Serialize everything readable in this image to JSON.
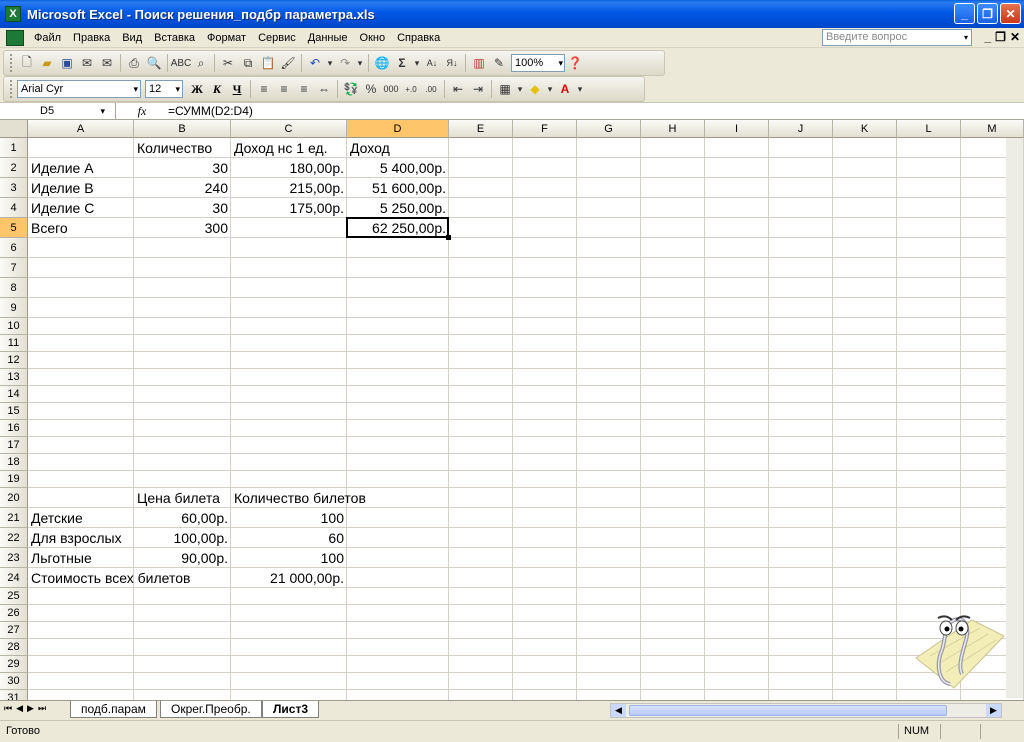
{
  "window": {
    "title": "Microsoft Excel - Поиск решения_подбр параметра.xls"
  },
  "menu": {
    "items": [
      "Файл",
      "Правка",
      "Вид",
      "Вставка",
      "Формат",
      "Сервис",
      "Данные",
      "Окно",
      "Справка"
    ],
    "help_placeholder": "Введите вопрос"
  },
  "toolbar": {
    "zoom": "100%"
  },
  "format_toolbar": {
    "font": "Arial Cyr",
    "size": "12",
    "bold": "Ж",
    "italic": "К",
    "underline": "Ч",
    "percent": "%",
    "thousands": "000"
  },
  "formula_bar": {
    "name_box": "D5",
    "fx": "fx",
    "formula": "=СУММ(D2:D4)"
  },
  "sheet": {
    "columns": [
      "A",
      "B",
      "C",
      "D",
      "E",
      "F",
      "G",
      "H",
      "I",
      "J",
      "K",
      "L",
      "M"
    ],
    "active_col": "D",
    "rows": [
      "1",
      "2",
      "3",
      "4",
      "5",
      "6",
      "7",
      "8",
      "9",
      "10",
      "11",
      "12",
      "13",
      "14",
      "15",
      "16",
      "17",
      "18",
      "19",
      "20",
      "21",
      "22",
      "23",
      "24",
      "25",
      "26",
      "27",
      "28",
      "29",
      "30",
      "31"
    ],
    "active_row": "5",
    "cells": [
      {
        "ref": "B1",
        "v": "Количество",
        "align": "l"
      },
      {
        "ref": "C1",
        "v": "Доход нс 1 ед.",
        "align": "l"
      },
      {
        "ref": "D1",
        "v": "Доход",
        "align": "l"
      },
      {
        "ref": "A2",
        "v": "Иделие А",
        "align": "l"
      },
      {
        "ref": "B2",
        "v": "30",
        "align": "r"
      },
      {
        "ref": "C2",
        "v": "180,00р.",
        "align": "r"
      },
      {
        "ref": "D2",
        "v": "5 400,00р.",
        "align": "r"
      },
      {
        "ref": "A3",
        "v": "Иделие В",
        "align": "l"
      },
      {
        "ref": "B3",
        "v": "240",
        "align": "r"
      },
      {
        "ref": "C3",
        "v": "215,00р.",
        "align": "r"
      },
      {
        "ref": "D3",
        "v": "51 600,00р.",
        "align": "r"
      },
      {
        "ref": "A4",
        "v": "Иделие С",
        "align": "l"
      },
      {
        "ref": "B4",
        "v": "30",
        "align": "r"
      },
      {
        "ref": "C4",
        "v": "175,00р.",
        "align": "r"
      },
      {
        "ref": "D4",
        "v": "5 250,00р.",
        "align": "r"
      },
      {
        "ref": "A5",
        "v": "Всего",
        "align": "l"
      },
      {
        "ref": "B5",
        "v": "300",
        "align": "r"
      },
      {
        "ref": "D5",
        "v": "62 250,00р.",
        "align": "r"
      },
      {
        "ref": "B20",
        "v": "Цена билета",
        "align": "l"
      },
      {
        "ref": "C20",
        "v": "Количество билетов",
        "align": "l"
      },
      {
        "ref": "A21",
        "v": "Детские",
        "align": "l"
      },
      {
        "ref": "B21",
        "v": "60,00р.",
        "align": "r"
      },
      {
        "ref": "C21",
        "v": "100",
        "align": "r"
      },
      {
        "ref": "A22",
        "v": "Для взрослых",
        "align": "l"
      },
      {
        "ref": "B22",
        "v": "100,00р.",
        "align": "r"
      },
      {
        "ref": "C22",
        "v": "60",
        "align": "r"
      },
      {
        "ref": "A23",
        "v": "Льготные",
        "align": "l"
      },
      {
        "ref": "B23",
        "v": "90,00р.",
        "align": "r"
      },
      {
        "ref": "C23",
        "v": "100",
        "align": "r"
      },
      {
        "ref": "A24",
        "v": "Стоимость всех билетов",
        "align": "l"
      },
      {
        "ref": "C24",
        "v": "21 000,00р.",
        "align": "r"
      }
    ]
  },
  "tabs": {
    "items": [
      "подб.парам",
      "Окрег.Преобр.",
      "Лист3"
    ],
    "active": "Лист3"
  },
  "status": {
    "text": "Готово",
    "num": "NUM"
  }
}
